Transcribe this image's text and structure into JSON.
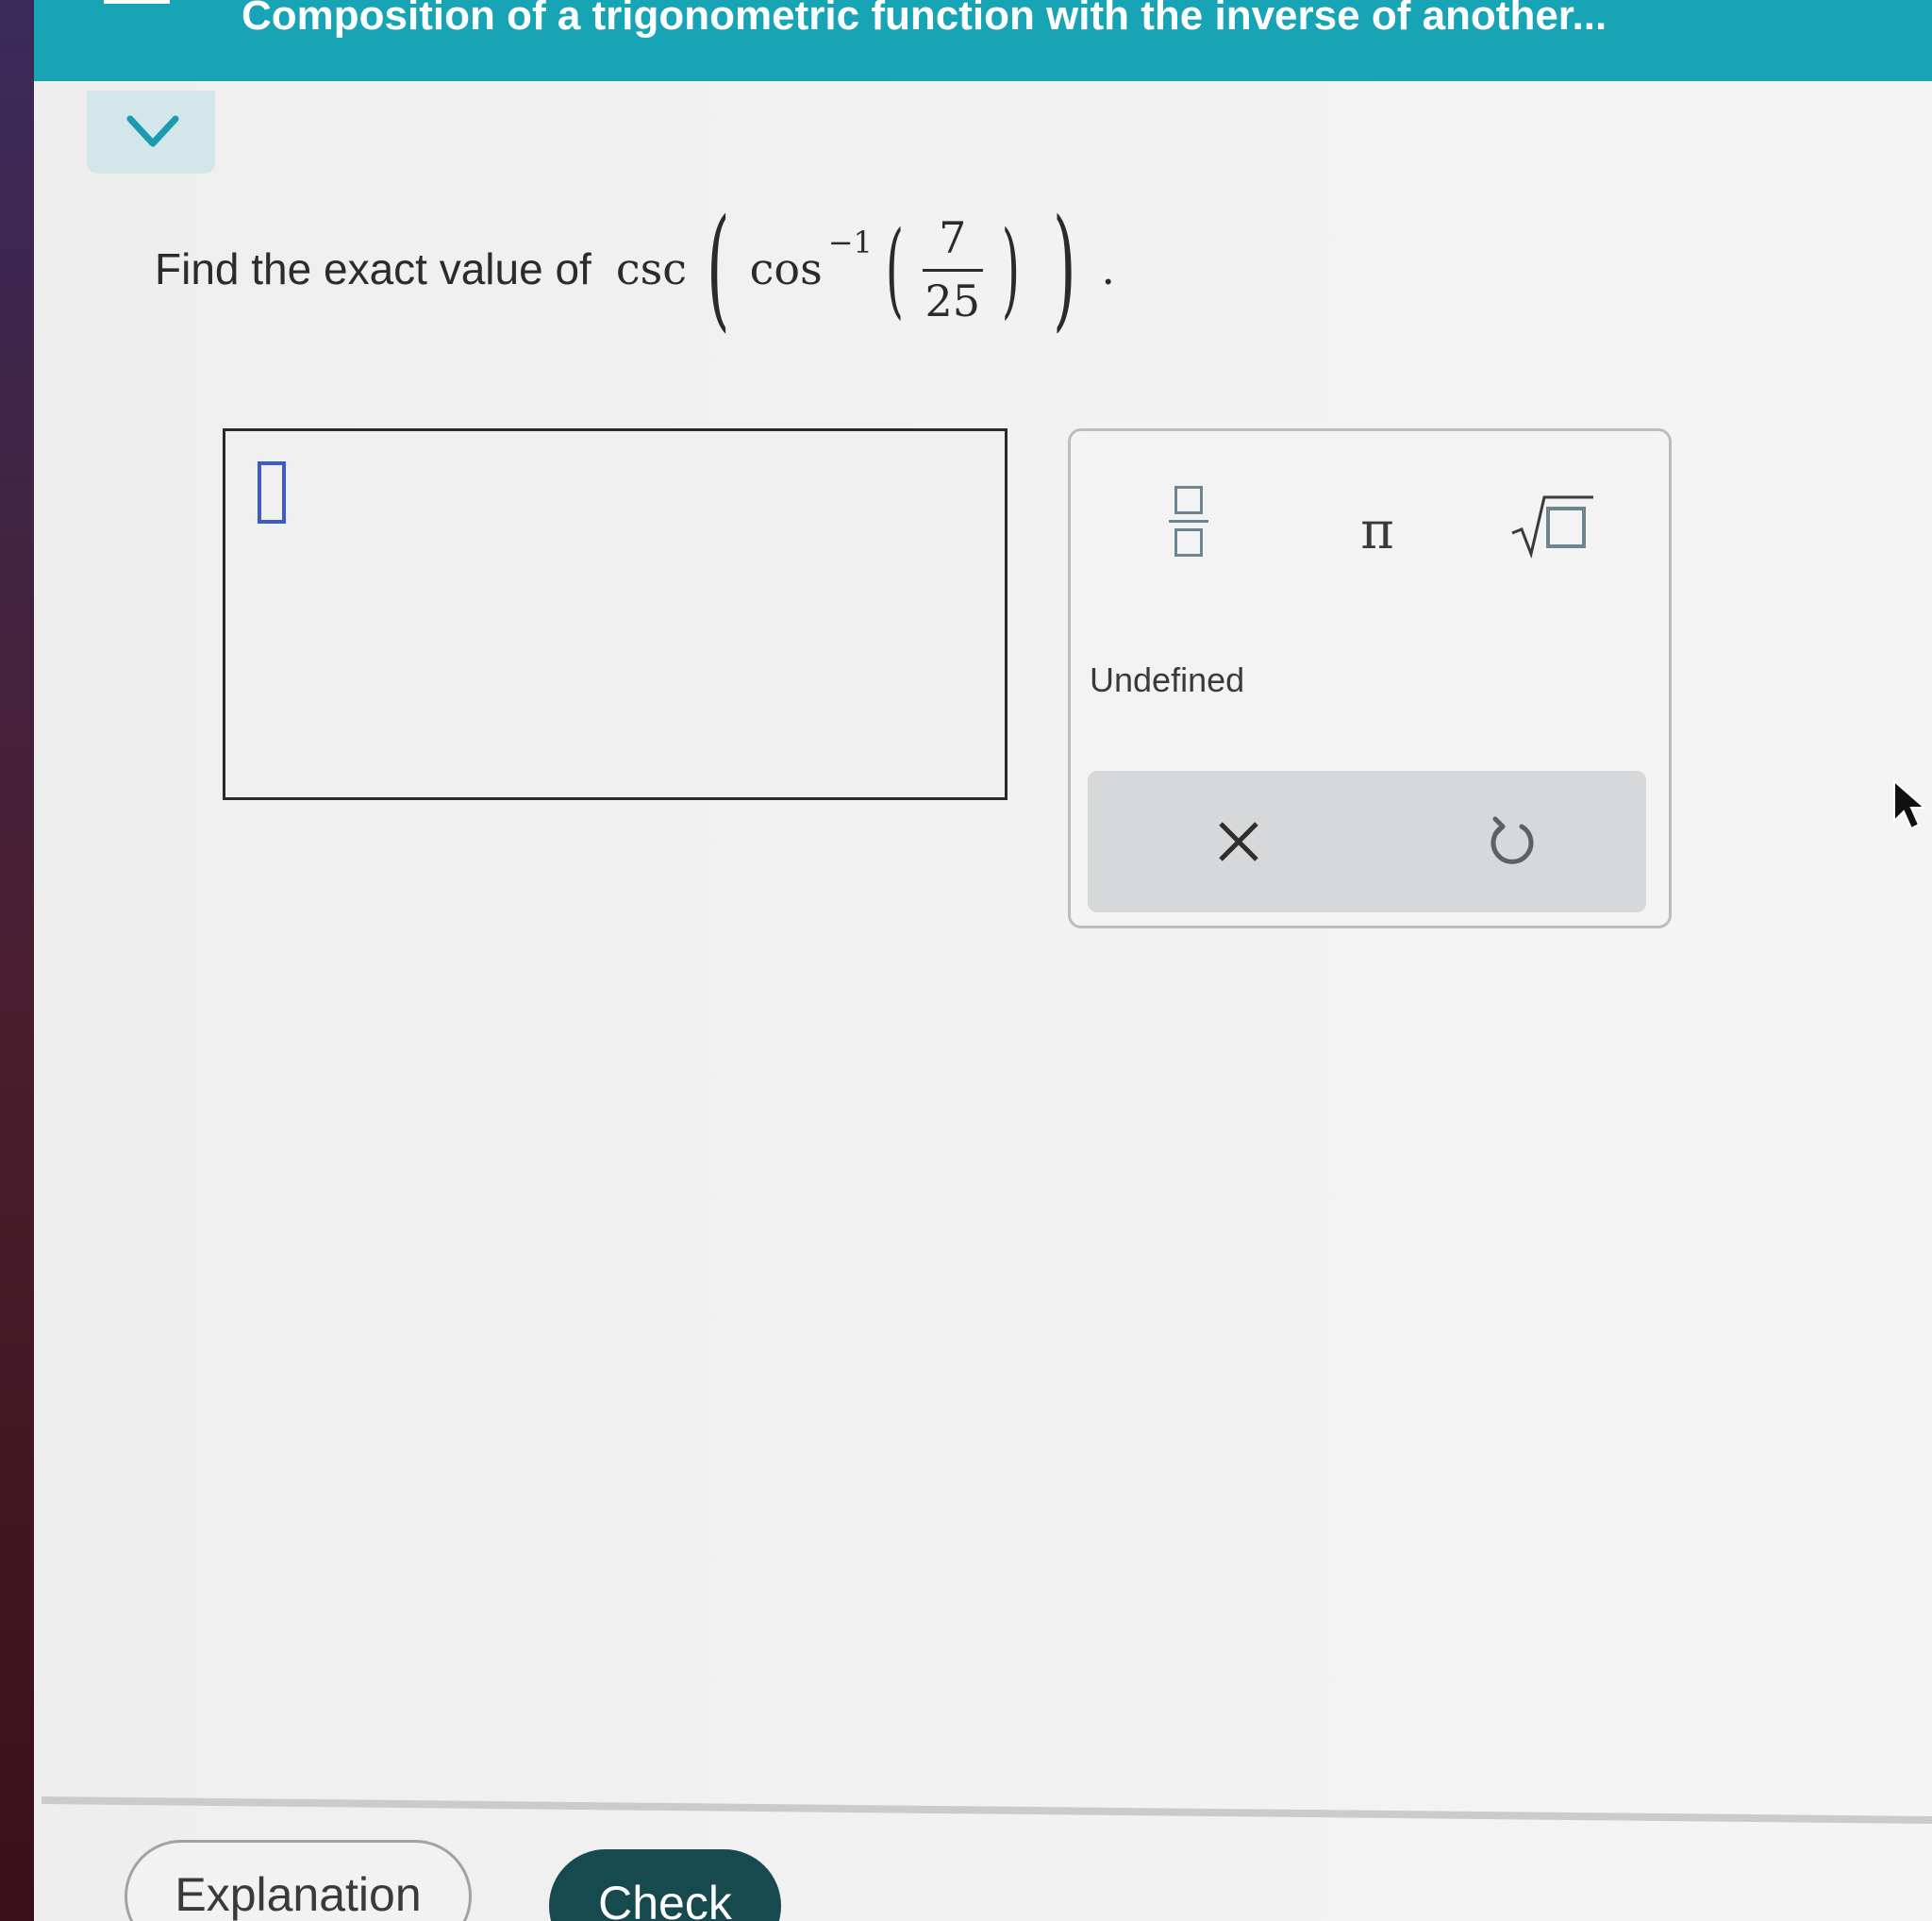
{
  "header": {
    "title": "Composition of a trigonometric function with the inverse of another..."
  },
  "question": {
    "lead": "Find the exact value of",
    "outer_function": "csc",
    "inner_function": "cos",
    "inverse_exponent": "−1",
    "numerator": "7",
    "denominator": "25",
    "terminator": "."
  },
  "keypad": {
    "fraction_key": "fraction",
    "pi_key": "π",
    "sqrt_key": "square root",
    "undefined_key": "Undefined",
    "clear_key": "×",
    "undo_key": "undo"
  },
  "footer": {
    "explanation_label": "Explanation",
    "check_label": "Check"
  },
  "colors": {
    "header_bg": "#17a4b4",
    "check_bg": "#174a4e",
    "cursor": "#3b5ccc"
  }
}
